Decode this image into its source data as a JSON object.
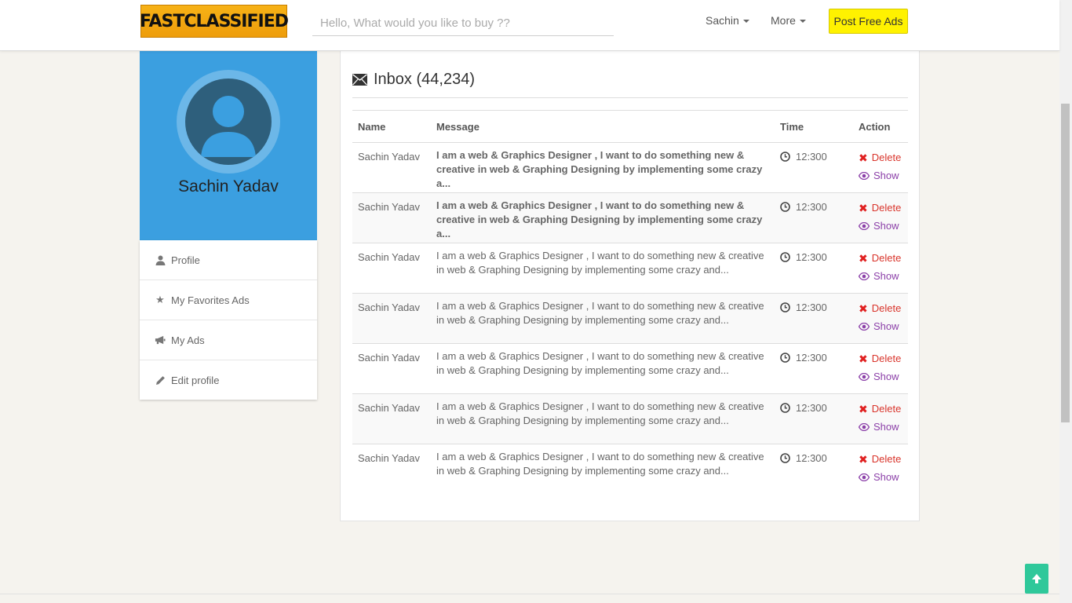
{
  "header": {
    "logo_text": "FASTCLASSIFIED",
    "search_placeholder": "Hello, What would you like to buy ??",
    "user_menu": "Sachin",
    "more_menu": "More",
    "post_button": "Post Free Ads"
  },
  "sidebar": {
    "profile_name": "Sachin Yadav",
    "items": [
      {
        "label": "Profile",
        "icon": "user-icon"
      },
      {
        "label": "My Favorites Ads",
        "icon": "star-icon"
      },
      {
        "label": "My Ads",
        "icon": "megaphone-icon"
      },
      {
        "label": "Edit profile",
        "icon": "pencil-icon"
      }
    ]
  },
  "inbox": {
    "title": "Inbox (44,234)",
    "columns": [
      "Name",
      "Message",
      "Time",
      "Action"
    ],
    "delete_label": "Delete",
    "show_label": "Show",
    "rows": [
      {
        "name": "Sachin Yadav",
        "message": "I am a web & Graphics Designer , I want to do something new & creative in web & Graphing Designing by implementing some crazy a...",
        "time": "12:300",
        "unread": true
      },
      {
        "name": "Sachin Yadav",
        "message": "I am a web & Graphics Designer , I want to do something new & creative in web & Graphing Designing by implementing some crazy a...",
        "time": "12:300",
        "unread": true
      },
      {
        "name": "Sachin Yadav",
        "message": "I am a web & Graphics Designer , I want to do something new & creative in web & Graphing Designing by implementing some crazy and...",
        "time": "12:300",
        "unread": false
      },
      {
        "name": "Sachin Yadav",
        "message": "I am a web & Graphics Designer , I want to do something new & creative in web & Graphing Designing by implementing some crazy and...",
        "time": "12:300",
        "unread": false
      },
      {
        "name": "Sachin Yadav",
        "message": "I am a web & Graphics Designer , I want to do something new & creative in web & Graphing Designing by implementing some crazy and...",
        "time": "12:300",
        "unread": false
      },
      {
        "name": "Sachin Yadav",
        "message": "I am a web & Graphics Designer , I want to do something new & creative in web & Graphing Designing by implementing some crazy and...",
        "time": "12:300",
        "unread": false
      },
      {
        "name": "Sachin Yadav",
        "message": "I am a web & Graphics Designer , I want to do something new & creative in web & Graphing Designing by implementing some crazy and...",
        "time": "12:300",
        "unread": false
      }
    ]
  },
  "colors": {
    "brand": "#f7b216",
    "post_button": "#fff200",
    "profile_bg": "#3b9fe0",
    "delete": "#d9342b",
    "show": "#8b3fa8",
    "to_top": "#2fc89a"
  }
}
